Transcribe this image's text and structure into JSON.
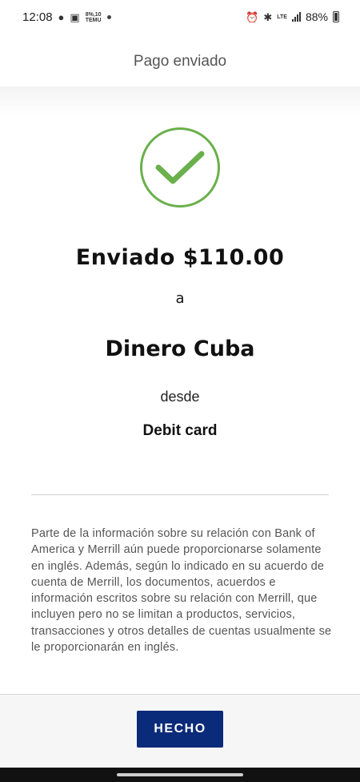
{
  "status_bar": {
    "time": "12:08",
    "temu_label": "TEMU",
    "temu_top": "8%,10",
    "lte_label": "LTE",
    "battery_percent": "88%"
  },
  "header": {
    "title": "Pago enviado"
  },
  "confirmation": {
    "amount_text": "Enviado $110.00",
    "connector_to": "a",
    "recipient": "Dinero Cuba",
    "connector_from": "desde",
    "source": "Debit card"
  },
  "disclaimer": {
    "text": "Parte de la información sobre su relación con Bank of America y Merrill aún puede proporcionarse solamente en inglés. Además, según lo indicado en su acuerdo de cuenta de Merrill, los documentos, acuerdos e información escritos sobre su relación con Merrill, que incluyen pero no se limitan a productos, servicios, transacciones y otros detalles de cuentas usualmente se le proporcionarán en inglés."
  },
  "footer": {
    "done_label": "HECHO"
  },
  "colors": {
    "accent_green": "#6ab04c",
    "button_navy": "#0a2a7a"
  }
}
